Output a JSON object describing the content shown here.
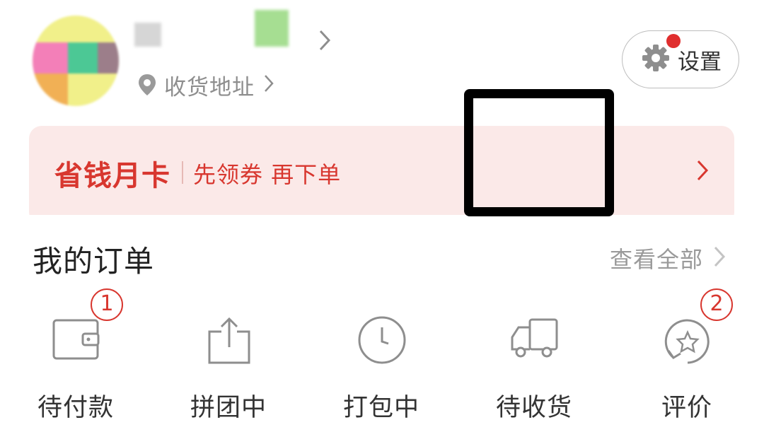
{
  "profile": {
    "address_label": "收货地址"
  },
  "settings": {
    "label": "设置"
  },
  "promo_card": {
    "title": "省钱月卡",
    "subtitle": "先领券 再下单"
  },
  "orders": {
    "heading": "我的订单",
    "view_all": "查看全部",
    "items": [
      {
        "label": "待付款",
        "icon": "wallet-icon",
        "badge": "1"
      },
      {
        "label": "拼团中",
        "icon": "share-icon",
        "badge": null
      },
      {
        "label": "打包中",
        "icon": "clock-icon",
        "badge": null
      },
      {
        "label": "待收货",
        "icon": "truck-icon",
        "badge": null
      },
      {
        "label": "评价",
        "icon": "star-review-icon",
        "badge": "2"
      }
    ]
  },
  "colors": {
    "accent_red": "#d8372f",
    "promo_bg": "#fbe9e8",
    "icon_gray": "#8e8e8e"
  }
}
